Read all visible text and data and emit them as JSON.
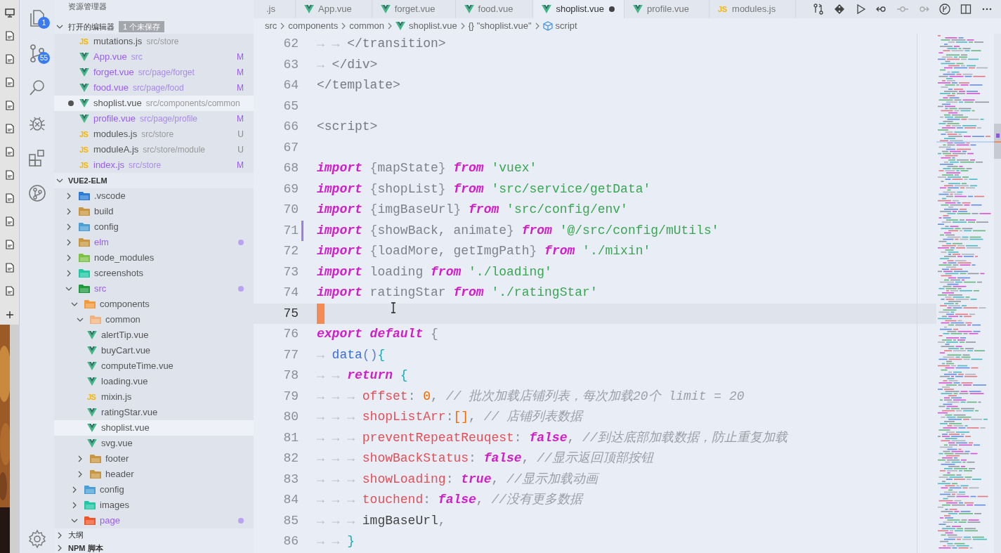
{
  "activity_bar": {
    "items": [
      {
        "kind": "explorer",
        "badge": "1"
      },
      {
        "kind": "source-control",
        "badge": "55"
      },
      {
        "kind": "search"
      },
      {
        "kind": "debug"
      },
      {
        "kind": "extensions"
      },
      {
        "kind": "timeline"
      }
    ],
    "bottom": [
      {
        "kind": "settings"
      }
    ]
  },
  "sidebar": {
    "title": "资源管理器",
    "open_editors": {
      "title": "打开的编辑器",
      "expanded": true,
      "badge": "1 个未保存",
      "items": [
        {
          "name": "mutations.js",
          "path": "src/store",
          "kind": "js",
          "icon_text": "JS",
          "modified": false,
          "dirty": false,
          "selected": false
        },
        {
          "name": "App.vue",
          "path": "src",
          "kind": "vue",
          "status": "M",
          "modified": true,
          "dirty": false,
          "selected": false
        },
        {
          "name": "forget.vue",
          "path": "src/page/forget",
          "kind": "vue",
          "status": "M",
          "modified": true,
          "dirty": false,
          "selected": false
        },
        {
          "name": "food.vue",
          "path": "src/page/food",
          "kind": "vue",
          "status": "M",
          "modified": true,
          "dirty": false,
          "selected": false
        },
        {
          "name": "shoplist.vue",
          "path": "src/components/common",
          "kind": "vue",
          "modified": false,
          "dirty": true,
          "selected": true
        },
        {
          "name": "profile.vue",
          "path": "src/page/profile",
          "kind": "vue",
          "status": "M",
          "modified": true,
          "dirty": false,
          "selected": false
        },
        {
          "name": "modules.js",
          "path": "src/store",
          "kind": "js",
          "icon_text": "JS",
          "status": "U",
          "modified": false,
          "dirty": false,
          "selected": false
        },
        {
          "name": "moduleA.js",
          "path": "src/store/module",
          "kind": "js",
          "icon_text": "JS",
          "status": "U",
          "modified": false,
          "dirty": false,
          "selected": false
        },
        {
          "name": "index.js",
          "path": "src/store",
          "kind": "js",
          "icon_text": "JS",
          "status": "M",
          "modified": true,
          "dirty": false,
          "selected": false
        }
      ]
    },
    "workspace": {
      "title": "VUE2-ELM",
      "expanded": true,
      "tree": [
        {
          "name": ".vscode",
          "kind": "vscode",
          "expanded": false,
          "modified": false,
          "selected": false
        },
        {
          "name": "build",
          "kind": "build",
          "expanded": false,
          "modified": false,
          "selected": false
        },
        {
          "name": "config",
          "kind": "config",
          "expanded": false,
          "modified": false,
          "selected": false
        },
        {
          "name": "elm",
          "kind": "folder",
          "expanded": false,
          "modified": true,
          "selected": false
        },
        {
          "name": "node_modules",
          "kind": "node",
          "expanded": false,
          "modified": false,
          "selected": false
        },
        {
          "name": "screenshots",
          "kind": "images",
          "expanded": false,
          "modified": false,
          "selected": false
        },
        {
          "name": "src",
          "kind": "src",
          "expanded": true,
          "modified": true,
          "selected": false,
          "children": [
            {
              "name": "components",
              "kind": "components",
              "expanded": true,
              "modified": false,
              "selected": false,
              "children": [
                {
                  "name": "common",
                  "kind": "common",
                  "expanded": true,
                  "modified": false,
                  "selected": false,
                  "children": [
                    {
                      "name": "alertTip.vue",
                      "kind": "vue",
                      "modified": false,
                      "selected": false
                    },
                    {
                      "name": "buyCart.vue",
                      "kind": "vue",
                      "modified": false,
                      "selected": false
                    },
                    {
                      "name": "computeTime.vue",
                      "kind": "vue",
                      "modified": false,
                      "selected": false
                    },
                    {
                      "name": "loading.vue",
                      "kind": "vue",
                      "modified": false,
                      "selected": false
                    },
                    {
                      "name": "mixin.js",
                      "kind": "js",
                      "icon_text": "JS",
                      "modified": false,
                      "selected": false
                    },
                    {
                      "name": "ratingStar.vue",
                      "kind": "vue",
                      "modified": false,
                      "selected": false
                    },
                    {
                      "name": "shoplist.vue",
                      "kind": "vue",
                      "modified": false,
                      "selected": true
                    },
                    {
                      "name": "svg.vue",
                      "kind": "vue",
                      "modified": false,
                      "selected": false
                    }
                  ]
                },
                {
                  "name": "footer",
                  "kind": "folder",
                  "expanded": false,
                  "modified": false,
                  "selected": false
                },
                {
                  "name": "header",
                  "kind": "folder",
                  "expanded": false,
                  "modified": false,
                  "selected": false
                }
              ]
            },
            {
              "name": "config",
              "kind": "config",
              "expanded": false,
              "modified": false,
              "selected": false
            },
            {
              "name": "images",
              "kind": "images",
              "expanded": false,
              "modified": false,
              "selected": false
            },
            {
              "name": "page",
              "kind": "page",
              "expanded": true,
              "modified": true,
              "selected": false
            }
          ]
        }
      ]
    },
    "panels": [
      {
        "title": "大纲",
        "expanded": false
      },
      {
        "title": "NPM 脚本",
        "expanded": false
      }
    ]
  },
  "tabs": [
    {
      "label": ".js",
      "selected": false,
      "dirty": false
    },
    {
      "label": "App.vue",
      "kind": "vue",
      "selected": false,
      "dirty": false
    },
    {
      "label": "forget.vue",
      "kind": "vue",
      "selected": false,
      "dirty": false
    },
    {
      "label": "food.vue",
      "kind": "vue",
      "selected": false,
      "dirty": false
    },
    {
      "label": "shoplist.vue",
      "kind": "vue",
      "selected": true,
      "dirty": true
    },
    {
      "label": "profile.vue",
      "kind": "vue",
      "selected": false,
      "dirty": false
    },
    {
      "label": "modules.js",
      "kind": "js",
      "icon_text": "JS",
      "selected": false,
      "dirty": false
    }
  ],
  "toolbar": [
    {
      "kind": "compare"
    },
    {
      "kind": "git"
    },
    {
      "kind": "run"
    },
    {
      "kind": "back"
    },
    {
      "kind": "commit"
    },
    {
      "kind": "forward"
    },
    {
      "kind": "gitlens"
    },
    {
      "kind": "split"
    },
    {
      "kind": "more"
    }
  ],
  "breadcrumbs": [
    {
      "label": "src",
      "kind": "folder"
    },
    {
      "label": "components",
      "kind": "folder"
    },
    {
      "label": "common",
      "kind": "folder"
    },
    {
      "label": "shoplist.vue",
      "kind": "file"
    },
    {
      "label": "\"shoplist.vue\"",
      "kind": "object",
      "icon_text": "{}"
    },
    {
      "label": "script",
      "kind": "element"
    }
  ],
  "editor": {
    "lines": [
      {
        "number": "62",
        "current": false,
        "changed": false,
        "tokens": [
          {
            "kind": "ws",
            "text": "→→"
          },
          {
            "kind": "tag",
            "text": "</transition>"
          }
        ]
      },
      {
        "number": "63",
        "current": false,
        "changed": false,
        "tokens": [
          {
            "kind": "ws",
            "text": "→"
          },
          {
            "kind": "tag",
            "text": "</div>"
          }
        ]
      },
      {
        "number": "64",
        "current": false,
        "changed": false,
        "tokens": [
          {
            "kind": "tag",
            "text": "</template>"
          }
        ]
      },
      {
        "number": "65",
        "current": false,
        "changed": false
      },
      {
        "number": "66",
        "current": false,
        "changed": false,
        "tokens": [
          {
            "kind": "tag",
            "text": "<script>"
          }
        ]
      },
      {
        "number": "67",
        "current": false,
        "changed": false
      },
      {
        "number": "68",
        "current": false,
        "changed": false,
        "tokens": [
          {
            "kind": "kw",
            "text": "import"
          },
          {
            "kind": "punct",
            "text": " {"
          },
          {
            "kind": "ident",
            "text": "mapState"
          },
          {
            "kind": "punct",
            "text": "} "
          },
          {
            "kind": "kw",
            "text": "from"
          },
          {
            "kind": "str",
            "text": " 'vuex'"
          }
        ]
      },
      {
        "number": "69",
        "current": false,
        "changed": false,
        "tokens": [
          {
            "kind": "kw",
            "text": "import"
          },
          {
            "kind": "punct",
            "text": " {"
          },
          {
            "kind": "ident",
            "text": "shopList"
          },
          {
            "kind": "punct",
            "text": "} "
          },
          {
            "kind": "kw",
            "text": "from"
          },
          {
            "kind": "str",
            "text": " 'src/service/getData'"
          }
        ]
      },
      {
        "number": "70",
        "current": false,
        "changed": false,
        "tokens": [
          {
            "kind": "kw",
            "text": "import"
          },
          {
            "kind": "punct",
            "text": " {"
          },
          {
            "kind": "ident",
            "text": "imgBaseUrl"
          },
          {
            "kind": "punct",
            "text": "} "
          },
          {
            "kind": "kw",
            "text": "from"
          },
          {
            "kind": "str",
            "text": " 'src/config/env'"
          }
        ]
      },
      {
        "number": "71",
        "current": false,
        "changed": true,
        "tokens": [
          {
            "kind": "kw",
            "text": "import"
          },
          {
            "kind": "punct",
            "text": " {"
          },
          {
            "kind": "ident",
            "text": "showBack, animate"
          },
          {
            "kind": "punct",
            "text": "} "
          },
          {
            "kind": "kw",
            "text": "from"
          },
          {
            "kind": "str",
            "text": " '@/src/config/mUtils'"
          }
        ]
      },
      {
        "number": "72",
        "current": false,
        "changed": false,
        "tokens": [
          {
            "kind": "kw",
            "text": "import"
          },
          {
            "kind": "punct",
            "text": " {"
          },
          {
            "kind": "ident",
            "text": "loadMore, getImgPath"
          },
          {
            "kind": "punct",
            "text": "} "
          },
          {
            "kind": "kw",
            "text": "from"
          },
          {
            "kind": "str",
            "text": " './mixin'"
          }
        ]
      },
      {
        "number": "73",
        "current": false,
        "changed": false,
        "tokens": [
          {
            "kind": "kw",
            "text": "import"
          },
          {
            "kind": "ident",
            "text": " loading "
          },
          {
            "kind": "kw",
            "text": "from"
          },
          {
            "kind": "str",
            "text": " './loading'"
          }
        ]
      },
      {
        "number": "74",
        "current": false,
        "changed": false,
        "tokens": [
          {
            "kind": "kw",
            "text": "import"
          },
          {
            "kind": "ident",
            "text": " ratingStar "
          },
          {
            "kind": "kw",
            "text": "from"
          },
          {
            "kind": "str",
            "text": " './ratingStar'"
          }
        ]
      },
      {
        "number": "75",
        "current": true,
        "changed": false
      },
      {
        "number": "76",
        "current": false,
        "changed": false,
        "tokens": [
          {
            "kind": "kw",
            "text": "export default"
          },
          {
            "kind": "punct",
            "text": " {"
          }
        ]
      },
      {
        "number": "77",
        "current": false,
        "changed": false,
        "tokens": [
          {
            "kind": "ws",
            "text": "→"
          },
          {
            "kind": "fn",
            "text": "data"
          },
          {
            "kind": "paren",
            "text": "()"
          },
          {
            "kind": "brace",
            "text": "{"
          }
        ]
      },
      {
        "number": "78",
        "current": false,
        "changed": false,
        "tokens": [
          {
            "kind": "ws",
            "text": "→→"
          },
          {
            "kind": "kw",
            "text": "return"
          },
          {
            "kind": "brace",
            "text": " {"
          }
        ]
      },
      {
        "number": "79",
        "current": false,
        "changed": false,
        "tokens": [
          {
            "kind": "ws",
            "text": "→→→"
          },
          {
            "kind": "prop",
            "text": "offset"
          },
          {
            "kind": "punct",
            "text": ": "
          },
          {
            "kind": "num",
            "text": "0"
          },
          {
            "kind": "punct",
            "text": ", "
          },
          {
            "kind": "comment",
            "text": "// 批次加载店铺列表，每次加载20个 limit = 20"
          }
        ]
      },
      {
        "number": "80",
        "current": false,
        "changed": false,
        "tokens": [
          {
            "kind": "ws",
            "text": "→→→"
          },
          {
            "kind": "prop",
            "text": "shopListArr"
          },
          {
            "kind": "punct",
            "text": ":"
          },
          {
            "kind": "num",
            "text": "[]"
          },
          {
            "kind": "punct",
            "text": ", "
          },
          {
            "kind": "comment",
            "text": "// 店铺列表数据"
          }
        ]
      },
      {
        "number": "81",
        "current": false,
        "changed": false,
        "tokens": [
          {
            "kind": "ws",
            "text": "→→→"
          },
          {
            "kind": "prop",
            "text": "preventRepeatReuqest"
          },
          {
            "kind": "punct",
            "text": ": "
          },
          {
            "kind": "bool",
            "text": "false"
          },
          {
            "kind": "punct",
            "text": ", "
          },
          {
            "kind": "comment",
            "text": "//到达底部加载数据，防止重复加载"
          }
        ]
      },
      {
        "number": "82",
        "current": false,
        "changed": false,
        "tokens": [
          {
            "kind": "ws",
            "text": "→→→"
          },
          {
            "kind": "prop",
            "text": "showBackStatus"
          },
          {
            "kind": "punct",
            "text": ": "
          },
          {
            "kind": "bool",
            "text": "false"
          },
          {
            "kind": "punct",
            "text": ", "
          },
          {
            "kind": "comment",
            "text": "//显示返回顶部按钮"
          }
        ]
      },
      {
        "number": "83",
        "current": false,
        "changed": false,
        "tokens": [
          {
            "kind": "ws",
            "text": "→→→"
          },
          {
            "kind": "prop",
            "text": "showLoading"
          },
          {
            "kind": "punct",
            "text": ": "
          },
          {
            "kind": "bool",
            "text": "true"
          },
          {
            "kind": "punct",
            "text": ", "
          },
          {
            "kind": "comment",
            "text": "//显示加载动画"
          }
        ]
      },
      {
        "number": "84",
        "current": false,
        "changed": false,
        "tokens": [
          {
            "kind": "ws",
            "text": "→→→"
          },
          {
            "kind": "prop",
            "text": "touchend"
          },
          {
            "kind": "punct",
            "text": ": "
          },
          {
            "kind": "bool",
            "text": "false"
          },
          {
            "kind": "punct",
            "text": ", "
          },
          {
            "kind": "comment",
            "text": "//没有更多数据"
          }
        ]
      },
      {
        "number": "85",
        "current": false,
        "changed": false,
        "tokens": [
          {
            "kind": "ws",
            "text": "→→→"
          },
          {
            "kind": "var",
            "text": "imgBaseUrl"
          },
          {
            "kind": "punct",
            "text": ","
          }
        ]
      },
      {
        "number": "86",
        "current": false,
        "changed": false,
        "tokens": [
          {
            "kind": "ws",
            "text": "→→"
          },
          {
            "kind": "brace",
            "text": "}"
          }
        ]
      }
    ]
  }
}
